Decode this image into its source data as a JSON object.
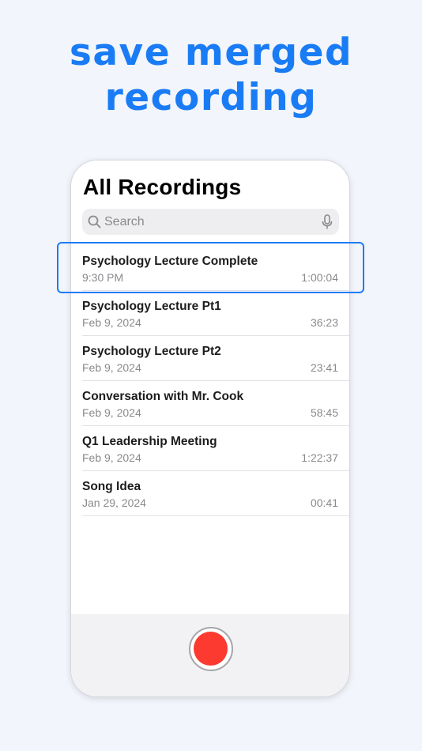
{
  "headline": {
    "line1": "save merged",
    "line2": "recording"
  },
  "app": {
    "title": "All Recordings",
    "search": {
      "placeholder": "Search",
      "value": ""
    },
    "icons": {
      "search": "search-icon",
      "mic": "microphone-icon",
      "record": "record-icon"
    },
    "recordings": [
      {
        "title": "Psychology Lecture Complete",
        "date": "9:30 PM",
        "duration": "1:00:04",
        "highlighted": true
      },
      {
        "title": "Psychology Lecture Pt1",
        "date": "Feb 9, 2024",
        "duration": "36:23"
      },
      {
        "title": "Psychology Lecture Pt2",
        "date": "Feb 9, 2024",
        "duration": "23:41"
      },
      {
        "title": "Conversation with Mr. Cook",
        "date": "Feb 9, 2024",
        "duration": "58:45"
      },
      {
        "title": "Q1 Leadership Meeting",
        "date": "Feb 9, 2024",
        "duration": "1:22:37"
      },
      {
        "title": "Song Idea",
        "date": "Jan 29, 2024",
        "duration": "00:41"
      }
    ]
  },
  "colors": {
    "accent": "#1a7cf5",
    "record": "#fc3a30",
    "background": "#f2f5fb"
  }
}
